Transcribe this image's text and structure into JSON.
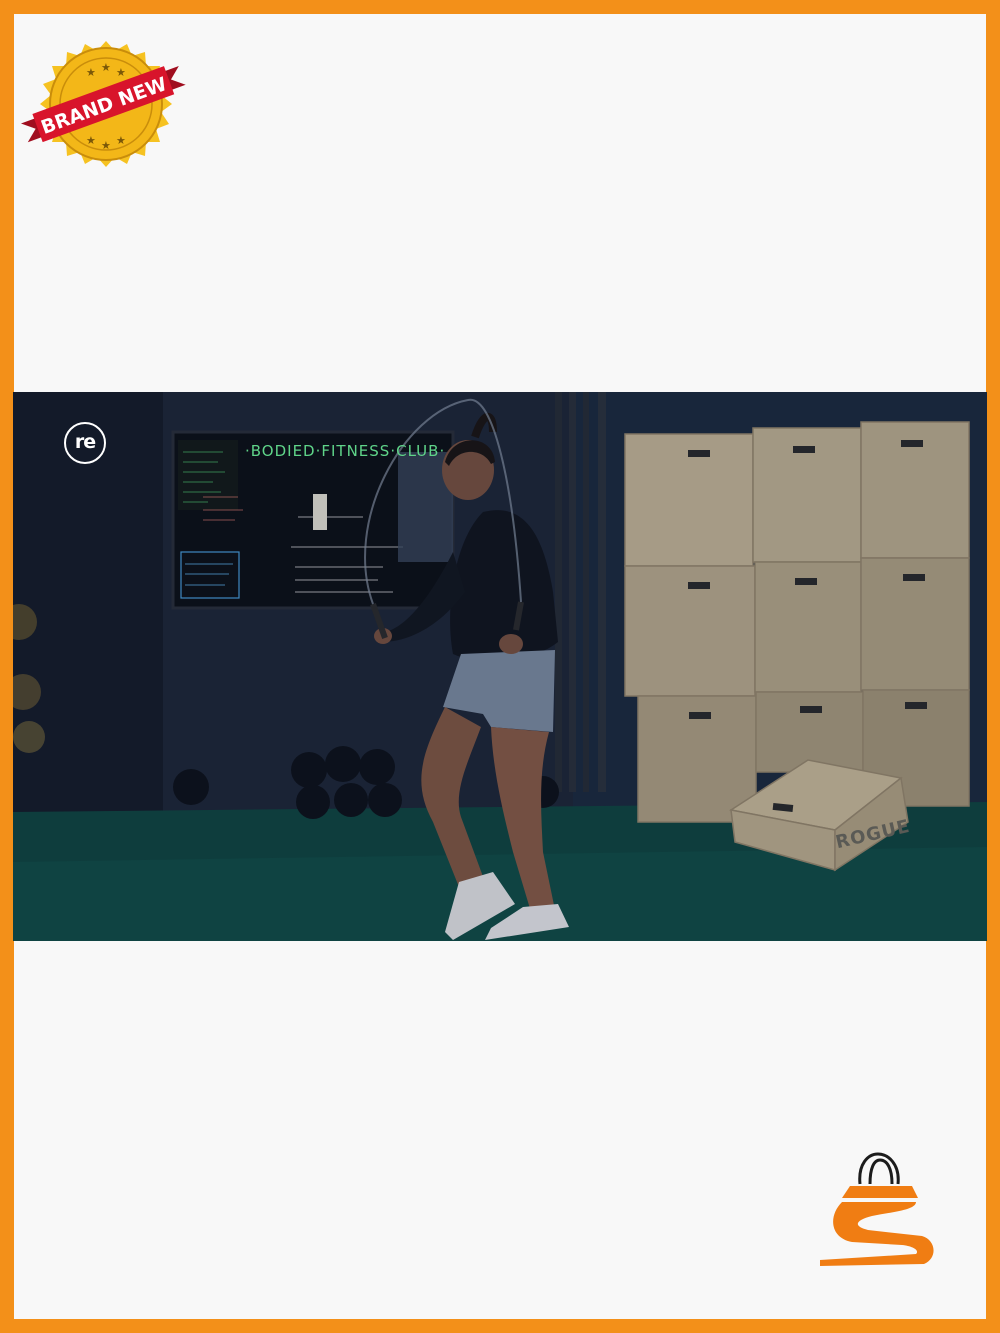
{
  "badge": {
    "text": "BRAND NEW",
    "ribbon_color": "#d8142b",
    "seal_color": "#f6c221"
  },
  "photo": {
    "app_logo": "re",
    "board_heading": "·BODIED·FITNESS·CLUB·",
    "box_brand": "ROGUE",
    "scene": "woman jumping rope in a gym beside plywood plyo boxes"
  },
  "shop_logo": {
    "icon": "shopping-bag-s-icon",
    "color": "#f07d13"
  },
  "frame": {
    "border_color": "#f39019"
  }
}
